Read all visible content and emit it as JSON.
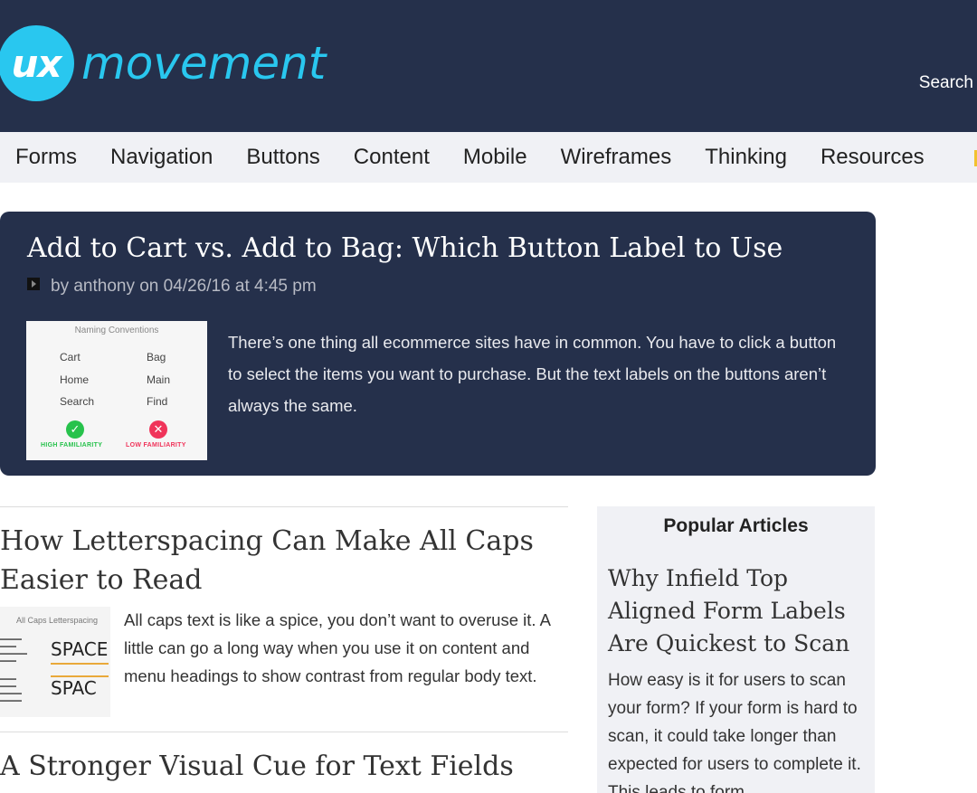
{
  "header": {
    "logo_mark": "ux",
    "logo_word": "movement",
    "search_label": "Search"
  },
  "nav": {
    "items": [
      "Forms",
      "Navigation",
      "Buttons",
      "Content",
      "Mobile",
      "Wireframes",
      "Thinking",
      "Resources"
    ]
  },
  "featured": {
    "title": "Add to Cart vs. Add to Bag: Which Button Label to Use",
    "byline": "by anthony on 04/26/16 at 4:45 pm",
    "excerpt": "There’s one thing all ecommerce sites have in common. You have to click a button to select the items you want to purchase. But the text labels on the buttons aren’t always the same.",
    "thumbnail": {
      "title": "Naming Conventions",
      "left": [
        "Cart",
        "Home",
        "Search"
      ],
      "right": [
        "Bag",
        "Main",
        "Find"
      ],
      "high_label": "HIGH FAMILIARITY",
      "low_label": "LOW FAMILIARITY",
      "colors": {
        "high": "#27c24c",
        "low": "#f0345a"
      }
    }
  },
  "articles": [
    {
      "title_line1": "How Letterspacing Can Make All Caps",
      "title_line2": "Easier to Read",
      "excerpt": "All caps text is like a spice, you don’t want to overuse it. A little can go a long way when you use it on content and menu headings to show contrast from regular body text.",
      "thumbnail": {
        "title": "All Caps Letterspacing",
        "word1": "SPACE",
        "word2": "SPAC"
      }
    },
    {
      "title_line1": "A Stronger Visual Cue for Text Fields"
    }
  ],
  "sidebar": {
    "heading": "Popular Articles",
    "article_title": "Why Infield Top Aligned Form Labels Are Quickest to Scan",
    "article_excerpt": "How easy is it for users to scan your form? If your form is hard to scan, it could take longer than expected for users to complete it. This leads to form"
  },
  "colors": {
    "header_bg": "#25304b",
    "brand_cyan": "#29c7ef",
    "nav_bg": "#f0f1f5"
  }
}
